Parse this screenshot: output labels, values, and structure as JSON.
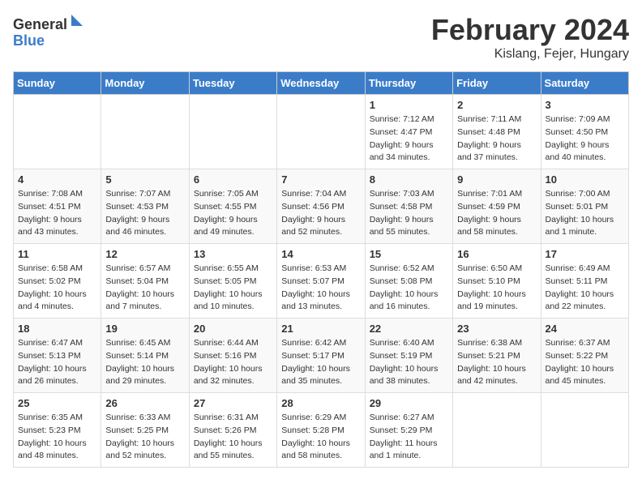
{
  "logo": {
    "general": "General",
    "blue": "Blue"
  },
  "header": {
    "month": "February 2024",
    "location": "Kislang, Fejer, Hungary"
  },
  "weekdays": [
    "Sunday",
    "Monday",
    "Tuesday",
    "Wednesday",
    "Thursday",
    "Friday",
    "Saturday"
  ],
  "weeks": [
    [
      {
        "day": "",
        "info": ""
      },
      {
        "day": "",
        "info": ""
      },
      {
        "day": "",
        "info": ""
      },
      {
        "day": "",
        "info": ""
      },
      {
        "day": "1",
        "info": "Sunrise: 7:12 AM\nSunset: 4:47 PM\nDaylight: 9 hours\nand 34 minutes."
      },
      {
        "day": "2",
        "info": "Sunrise: 7:11 AM\nSunset: 4:48 PM\nDaylight: 9 hours\nand 37 minutes."
      },
      {
        "day": "3",
        "info": "Sunrise: 7:09 AM\nSunset: 4:50 PM\nDaylight: 9 hours\nand 40 minutes."
      }
    ],
    [
      {
        "day": "4",
        "info": "Sunrise: 7:08 AM\nSunset: 4:51 PM\nDaylight: 9 hours\nand 43 minutes."
      },
      {
        "day": "5",
        "info": "Sunrise: 7:07 AM\nSunset: 4:53 PM\nDaylight: 9 hours\nand 46 minutes."
      },
      {
        "day": "6",
        "info": "Sunrise: 7:05 AM\nSunset: 4:55 PM\nDaylight: 9 hours\nand 49 minutes."
      },
      {
        "day": "7",
        "info": "Sunrise: 7:04 AM\nSunset: 4:56 PM\nDaylight: 9 hours\nand 52 minutes."
      },
      {
        "day": "8",
        "info": "Sunrise: 7:03 AM\nSunset: 4:58 PM\nDaylight: 9 hours\nand 55 minutes."
      },
      {
        "day": "9",
        "info": "Sunrise: 7:01 AM\nSunset: 4:59 PM\nDaylight: 9 hours\nand 58 minutes."
      },
      {
        "day": "10",
        "info": "Sunrise: 7:00 AM\nSunset: 5:01 PM\nDaylight: 10 hours\nand 1 minute."
      }
    ],
    [
      {
        "day": "11",
        "info": "Sunrise: 6:58 AM\nSunset: 5:02 PM\nDaylight: 10 hours\nand 4 minutes."
      },
      {
        "day": "12",
        "info": "Sunrise: 6:57 AM\nSunset: 5:04 PM\nDaylight: 10 hours\nand 7 minutes."
      },
      {
        "day": "13",
        "info": "Sunrise: 6:55 AM\nSunset: 5:05 PM\nDaylight: 10 hours\nand 10 minutes."
      },
      {
        "day": "14",
        "info": "Sunrise: 6:53 AM\nSunset: 5:07 PM\nDaylight: 10 hours\nand 13 minutes."
      },
      {
        "day": "15",
        "info": "Sunrise: 6:52 AM\nSunset: 5:08 PM\nDaylight: 10 hours\nand 16 minutes."
      },
      {
        "day": "16",
        "info": "Sunrise: 6:50 AM\nSunset: 5:10 PM\nDaylight: 10 hours\nand 19 minutes."
      },
      {
        "day": "17",
        "info": "Sunrise: 6:49 AM\nSunset: 5:11 PM\nDaylight: 10 hours\nand 22 minutes."
      }
    ],
    [
      {
        "day": "18",
        "info": "Sunrise: 6:47 AM\nSunset: 5:13 PM\nDaylight: 10 hours\nand 26 minutes."
      },
      {
        "day": "19",
        "info": "Sunrise: 6:45 AM\nSunset: 5:14 PM\nDaylight: 10 hours\nand 29 minutes."
      },
      {
        "day": "20",
        "info": "Sunrise: 6:44 AM\nSunset: 5:16 PM\nDaylight: 10 hours\nand 32 minutes."
      },
      {
        "day": "21",
        "info": "Sunrise: 6:42 AM\nSunset: 5:17 PM\nDaylight: 10 hours\nand 35 minutes."
      },
      {
        "day": "22",
        "info": "Sunrise: 6:40 AM\nSunset: 5:19 PM\nDaylight: 10 hours\nand 38 minutes."
      },
      {
        "day": "23",
        "info": "Sunrise: 6:38 AM\nSunset: 5:21 PM\nDaylight: 10 hours\nand 42 minutes."
      },
      {
        "day": "24",
        "info": "Sunrise: 6:37 AM\nSunset: 5:22 PM\nDaylight: 10 hours\nand 45 minutes."
      }
    ],
    [
      {
        "day": "25",
        "info": "Sunrise: 6:35 AM\nSunset: 5:23 PM\nDaylight: 10 hours\nand 48 minutes."
      },
      {
        "day": "26",
        "info": "Sunrise: 6:33 AM\nSunset: 5:25 PM\nDaylight: 10 hours\nand 52 minutes."
      },
      {
        "day": "27",
        "info": "Sunrise: 6:31 AM\nSunset: 5:26 PM\nDaylight: 10 hours\nand 55 minutes."
      },
      {
        "day": "28",
        "info": "Sunrise: 6:29 AM\nSunset: 5:28 PM\nDaylight: 10 hours\nand 58 minutes."
      },
      {
        "day": "29",
        "info": "Sunrise: 6:27 AM\nSunset: 5:29 PM\nDaylight: 11 hours\nand 1 minute."
      },
      {
        "day": "",
        "info": ""
      },
      {
        "day": "",
        "info": ""
      }
    ]
  ]
}
